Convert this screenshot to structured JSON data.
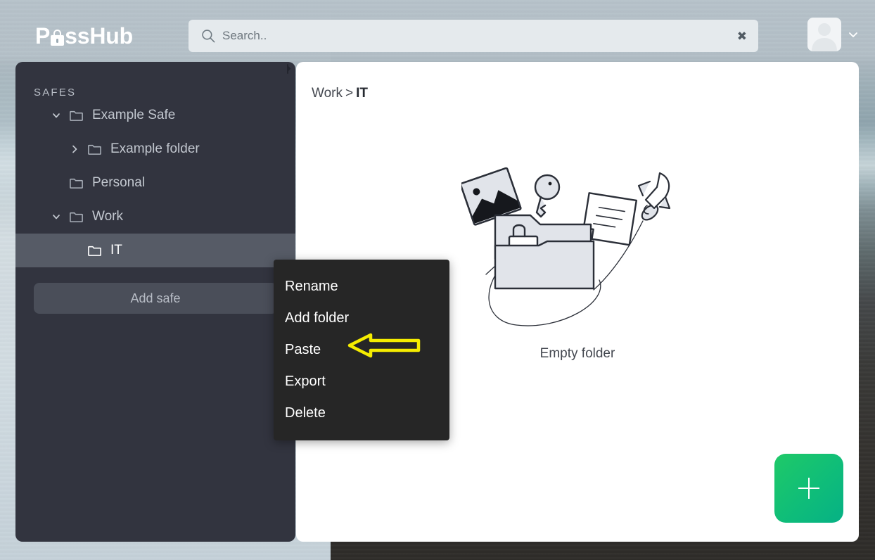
{
  "app": {
    "brand_name": "PassHub",
    "brand_name_prefix": "P",
    "brand_name_suffix": "ssHub",
    "accent_color": "#0fbd79",
    "sidebar_color": "#32343f",
    "menu_color": "#262626",
    "annotation_color": "#f5ec00"
  },
  "header": {
    "search": {
      "placeholder": "Search..",
      "value": "",
      "icon": "search-icon",
      "clear_icon": "✖"
    },
    "user": {
      "avatar_icon": "user-avatar-icon",
      "caret_icon": "chevron-down-icon"
    }
  },
  "sidebar": {
    "title": "SAFES",
    "grip_icon": "resize-grip-icon",
    "items": [
      {
        "label": "Example Safe",
        "depth": 0,
        "caret": "chevron-down",
        "selected": false,
        "icon": "folder-icon"
      },
      {
        "label": "Example folder",
        "depth": 1,
        "caret": "chevron-right",
        "selected": false,
        "icon": "folder-icon"
      },
      {
        "label": "Personal",
        "depth": 0,
        "caret": "none",
        "selected": false,
        "icon": "folder-icon"
      },
      {
        "label": "Work",
        "depth": 0,
        "caret": "chevron-down",
        "selected": false,
        "icon": "folder-icon"
      },
      {
        "label": "IT",
        "depth": 1,
        "caret": "none",
        "selected": true,
        "icon": "folder-icon"
      }
    ],
    "add_safe_label": "Add safe"
  },
  "main": {
    "breadcrumb": {
      "parent": "Work",
      "separator": ">",
      "current": "IT"
    },
    "empty_state": {
      "label": "Empty folder",
      "illustration": "empty-folder-illustration"
    },
    "fab": {
      "label": "+",
      "icon": "plus-icon"
    }
  },
  "context_menu": {
    "items": [
      {
        "label": "Rename"
      },
      {
        "label": "Add folder"
      },
      {
        "label": "Paste"
      },
      {
        "label": "Export"
      },
      {
        "label": "Delete"
      }
    ]
  },
  "annotation": {
    "arrow_icon": "left-arrow-annotation",
    "points_at": "Paste"
  }
}
